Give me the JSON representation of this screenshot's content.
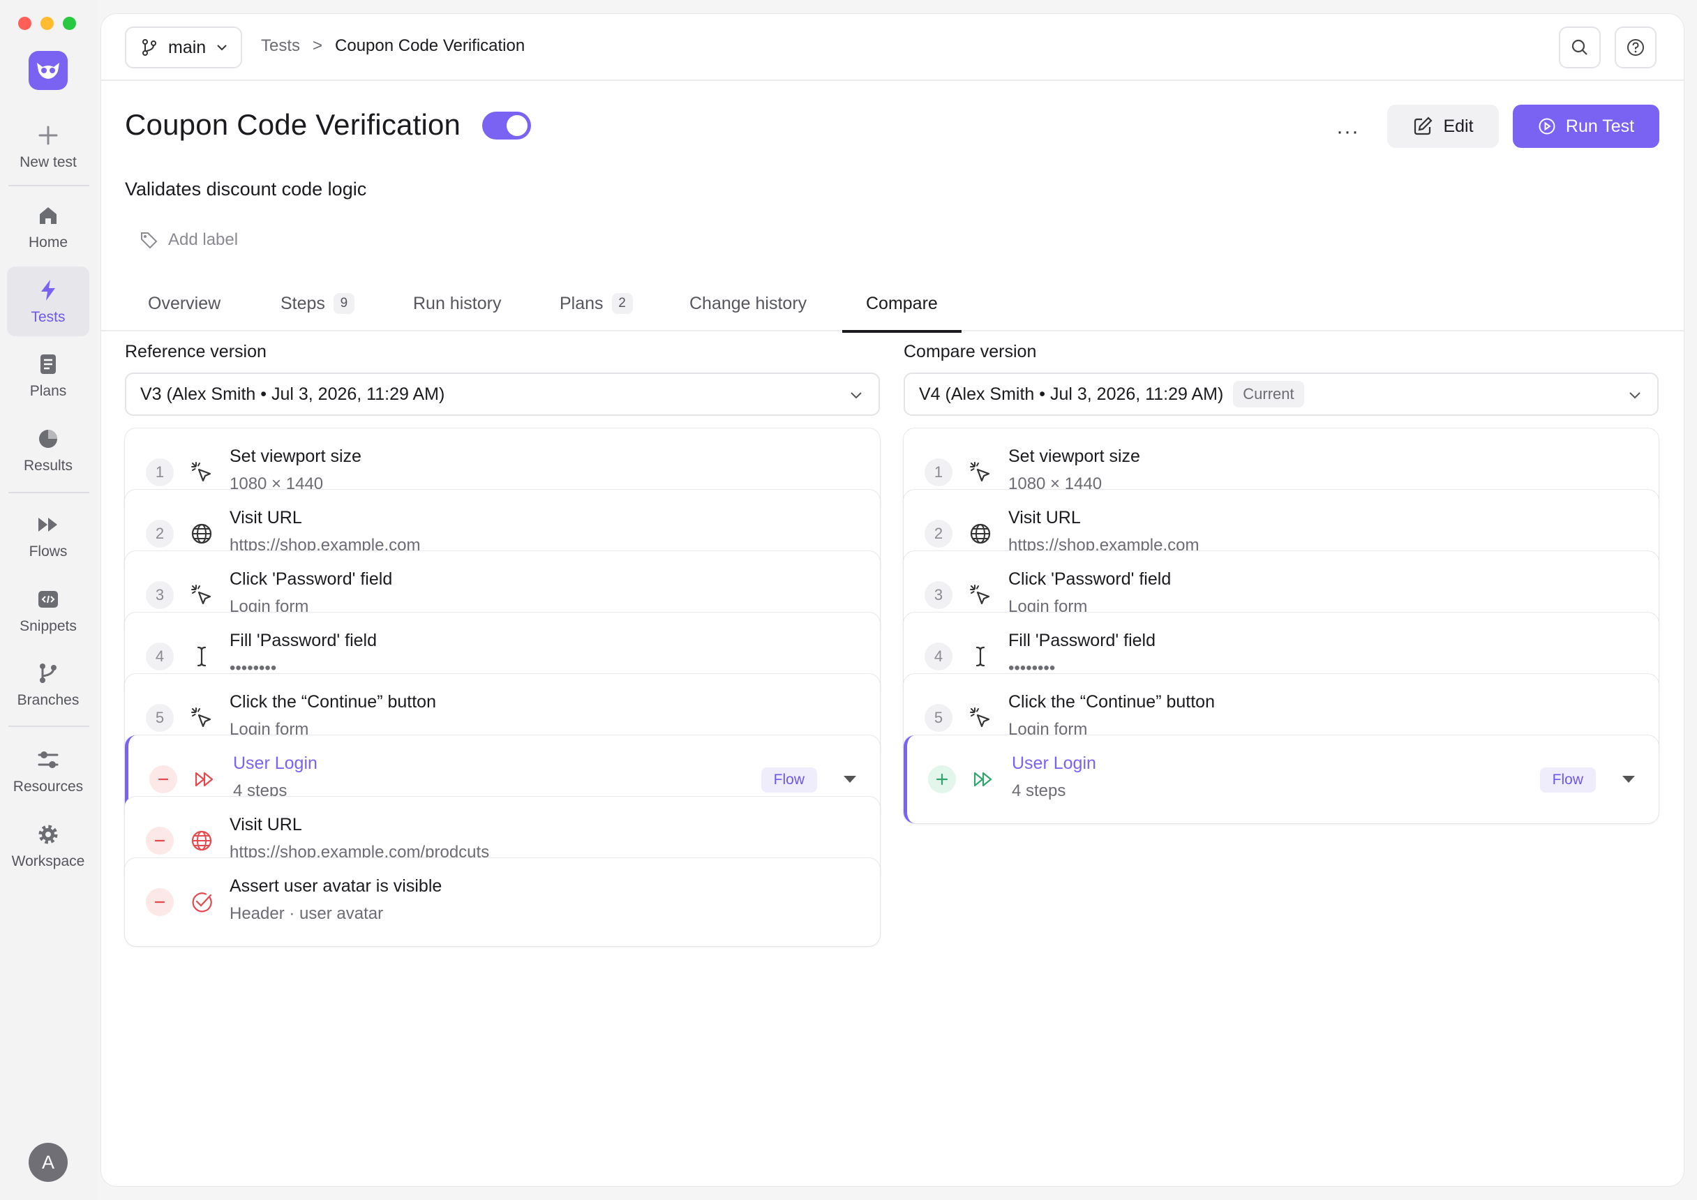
{
  "sidebar": {
    "new_test": "New test",
    "items": [
      {
        "label": "Home",
        "icon": "home-icon"
      },
      {
        "label": "Tests",
        "icon": "bolt-icon",
        "active": true
      },
      {
        "label": "Plans",
        "icon": "document-icon"
      },
      {
        "label": "Results",
        "icon": "pie-chart-icon"
      },
      {
        "label": "Flows",
        "icon": "fast-forward-icon"
      },
      {
        "label": "Snippets",
        "icon": "code-icon"
      },
      {
        "label": "Branches",
        "icon": "branch-icon"
      },
      {
        "label": "Resources",
        "icon": "sliders-icon"
      },
      {
        "label": "Workspace",
        "icon": "gear-icon"
      }
    ],
    "avatar": "A"
  },
  "topbar": {
    "branch": "main",
    "breadcrumb": {
      "parent": "Tests",
      "separator": ">",
      "current": "Coupon Code Verification"
    }
  },
  "header": {
    "title": "Coupon Code Verification",
    "more": "···",
    "edit_label": "Edit",
    "run_label": "Run Test",
    "description": "Validates discount code logic",
    "add_label": "Add label"
  },
  "tabs": [
    {
      "label": "Overview"
    },
    {
      "label": "Steps",
      "count": "9"
    },
    {
      "label": "Run history"
    },
    {
      "label": "Plans",
      "count": "2"
    },
    {
      "label": "Change history"
    },
    {
      "label": "Compare",
      "active": true
    }
  ],
  "reference": {
    "heading": "Reference version",
    "version": "V3 (Alex Smith • Jul 3, 2026, 11:29 AM)",
    "steps": [
      {
        "num": "1",
        "icon": "pointer-click-icon",
        "title": "Set viewport size",
        "sub": "1080 × 1440"
      },
      {
        "num": "2",
        "icon": "globe-icon",
        "title": "Visit URL",
        "sub": "https://shop.example.com",
        "link": true
      },
      {
        "num": "3",
        "icon": "pointer-click-icon",
        "title": "Click 'Password' field",
        "sub": "Login form"
      },
      {
        "num": "4",
        "icon": "text-cursor-icon",
        "title": "Fill 'Password' field",
        "sub": "••••••••"
      },
      {
        "num": "5",
        "icon": "pointer-click-icon",
        "title": "Click the “Continue” button",
        "sub": "Login form"
      },
      {
        "num": "—",
        "icon": "flow-icon",
        "title": "User Login",
        "sub": "4 steps",
        "flow": true,
        "badge": "Flow",
        "diff": "removed"
      },
      {
        "num": "—",
        "icon": "globe-icon",
        "title": "Visit URL",
        "sub": "https://shop.example.com/prodcuts",
        "link": true,
        "diff": "removed"
      },
      {
        "num": "—",
        "icon": "check-circle-icon",
        "title": "Assert user avatar is visible",
        "sub": "Header · user avatar",
        "diff": "removed"
      }
    ]
  },
  "compare": {
    "heading": "Compare version",
    "version": "V4 (Alex Smith • Jul 3, 2026, 11:29 AM)",
    "current_badge": "Current",
    "steps": [
      {
        "num": "1",
        "icon": "pointer-click-icon",
        "title": "Set viewport size",
        "sub": "1080 × 1440"
      },
      {
        "num": "2",
        "icon": "globe-icon",
        "title": "Visit URL",
        "sub": "https://shop.example.com",
        "link": true
      },
      {
        "num": "3",
        "icon": "pointer-click-icon",
        "title": "Click 'Password' field",
        "sub": "Login form"
      },
      {
        "num": "4",
        "icon": "text-cursor-icon",
        "title": "Fill 'Password' field",
        "sub": "••••••••"
      },
      {
        "num": "5",
        "icon": "pointer-click-icon",
        "title": "Click the “Continue” button",
        "sub": "Login form"
      },
      {
        "num": "+",
        "icon": "flow-icon",
        "title": "User Login",
        "sub": "4 steps",
        "flow": true,
        "badge": "Flow",
        "diff": "added"
      }
    ]
  },
  "colors": {
    "accent": "#7a63f3",
    "removed": "#e5484d",
    "added": "#30a46c"
  }
}
